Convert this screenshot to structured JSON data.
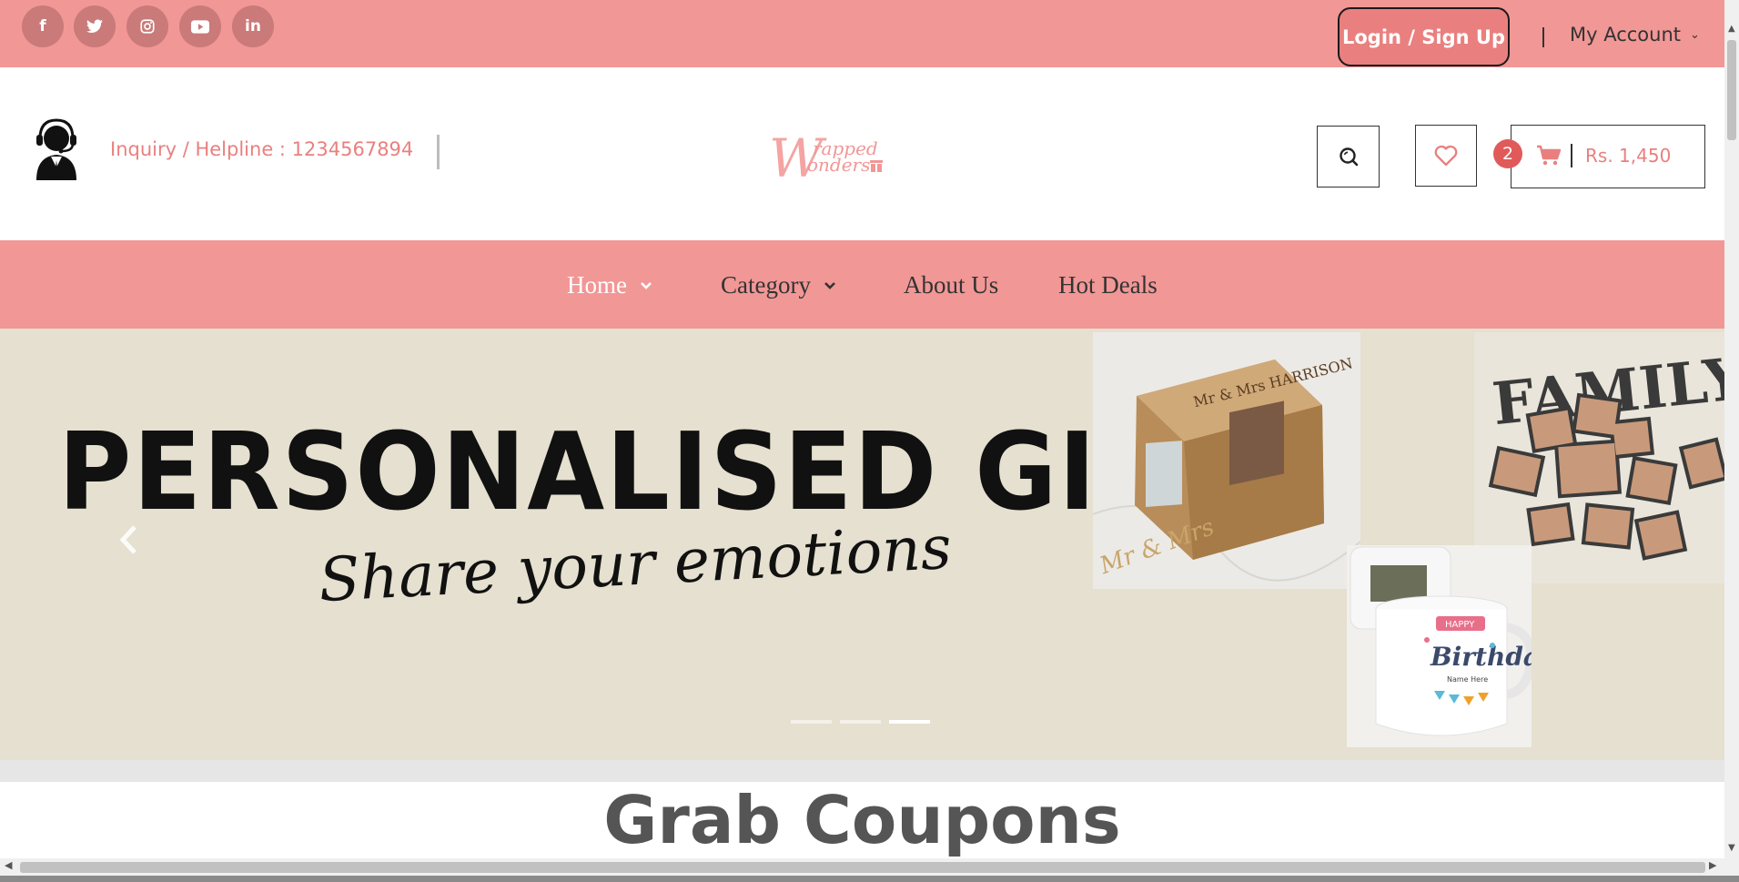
{
  "colors": {
    "brand_pink": "#f19796",
    "accent_pink": "#e9807f",
    "badge_red": "#e15a5a",
    "hero_bg": "#e5e0cf"
  },
  "topbar": {
    "social_icons": [
      {
        "name": "facebook-icon",
        "glyph": "f"
      },
      {
        "name": "twitter-icon",
        "glyph": "🐦"
      },
      {
        "name": "instagram-icon",
        "glyph": "◎"
      },
      {
        "name": "youtube-icon",
        "glyph": "▶"
      },
      {
        "name": "linkedin-icon",
        "glyph": "in"
      }
    ],
    "login_label": "Login / Sign Up",
    "account_label": "My Account"
  },
  "header": {
    "helpline": "Inquiry / Helpline : 1234567894",
    "logo_text": "Wrapped Wonders",
    "cart_count": "2",
    "cart_total": "Rs. 1,450"
  },
  "nav": {
    "items": [
      {
        "label": "Home",
        "has_dropdown": true,
        "active": true
      },
      {
        "label": "Category",
        "has_dropdown": true,
        "active": false
      },
      {
        "label": "About Us",
        "has_dropdown": false,
        "active": false
      },
      {
        "label": "Hot Deals",
        "has_dropdown": false,
        "active": false
      }
    ]
  },
  "hero": {
    "title": "PERSONALISED GIFTS",
    "subtitle": "Share your emotions",
    "box_text": "Mr & Mrs HARRISON",
    "box_script": "Mr & Mrs",
    "family_text": "FAMILY",
    "mug_banner": "HAPPY",
    "mug_text": "Birthday",
    "mug_name": "Name Here",
    "slide_count": 3,
    "active_slide": 3
  },
  "coupons": {
    "title": "Grab Coupons"
  }
}
